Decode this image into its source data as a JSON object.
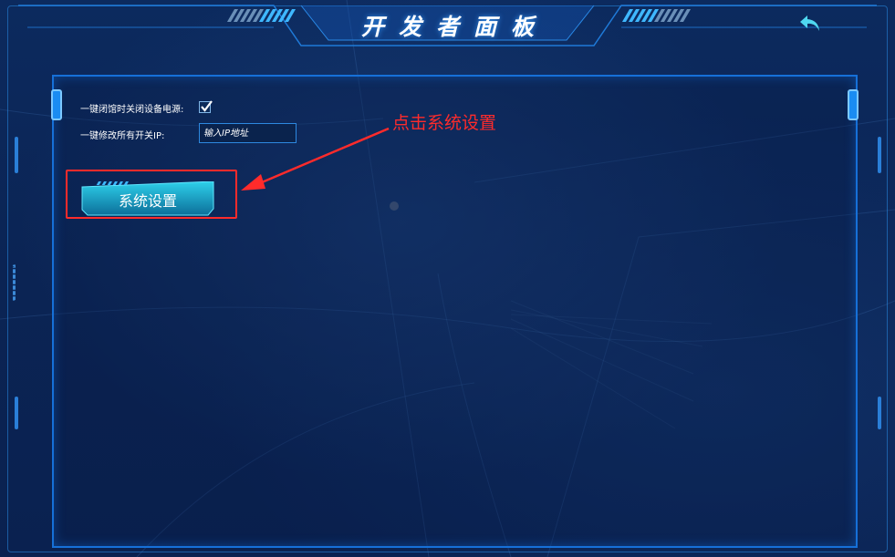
{
  "header": {
    "title": "开发者面板",
    "back_icon": "undo-arrow-icon"
  },
  "settings": {
    "power_off_label": "一键闭馆时关闭设备电源:",
    "power_off_checked": true,
    "ip_label": "一键修改所有开关IP:",
    "ip_placeholder": "输入IP地址"
  },
  "system_button": {
    "label": "系统设置"
  },
  "annotation": {
    "text": "点击系统设置",
    "color": "#ff2b2b"
  },
  "colors": {
    "accent": "#1a8cf2",
    "background": "#0a2350",
    "button": "#1bb5d6"
  }
}
